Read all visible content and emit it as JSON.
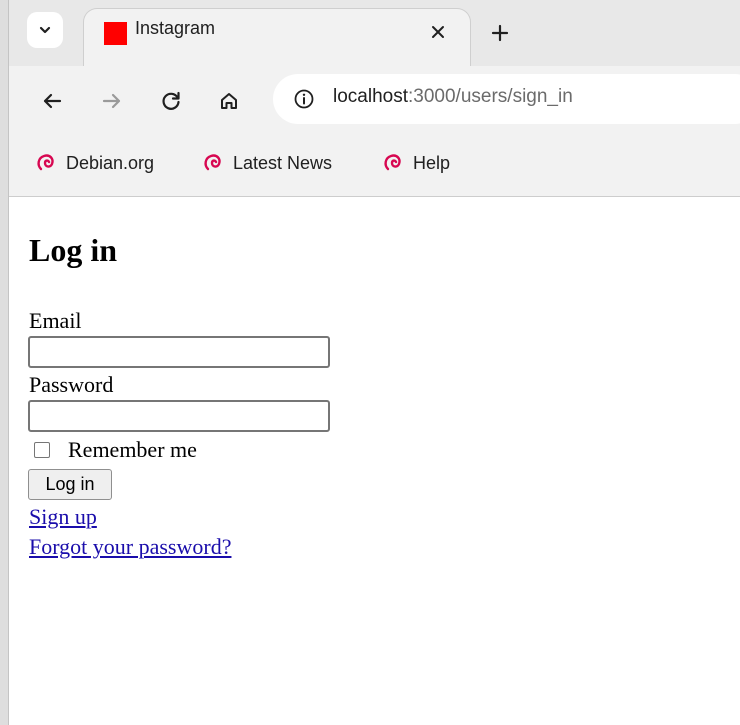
{
  "browser": {
    "tab": {
      "title": "Instagram",
      "favicon_color": "#ff0000"
    },
    "icons": {
      "tab_list": "chevron-down-icon",
      "close": "close-icon",
      "new_tab": "plus-icon",
      "back": "back-arrow-icon",
      "forward": "forward-arrow-icon",
      "reload": "reload-icon",
      "home": "home-icon",
      "site_info": "info-icon",
      "bookmark": "debian-swirl-icon"
    },
    "address": {
      "host": "localhost",
      "path": ":3000/users/sign_in"
    },
    "bookmarks": [
      "Debian.org",
      "Latest News",
      "Help"
    ],
    "bookmark_icon_color": "#d70751"
  },
  "page": {
    "heading": "Log in",
    "email_label": "Email",
    "email_value": "",
    "password_label": "Password",
    "password_value": "",
    "remember_label": "Remember me",
    "submit_label": "Log in",
    "sign_up_link": "Sign up",
    "forgot_link": "Forgot your password?",
    "link_color": "#1a0dab"
  }
}
